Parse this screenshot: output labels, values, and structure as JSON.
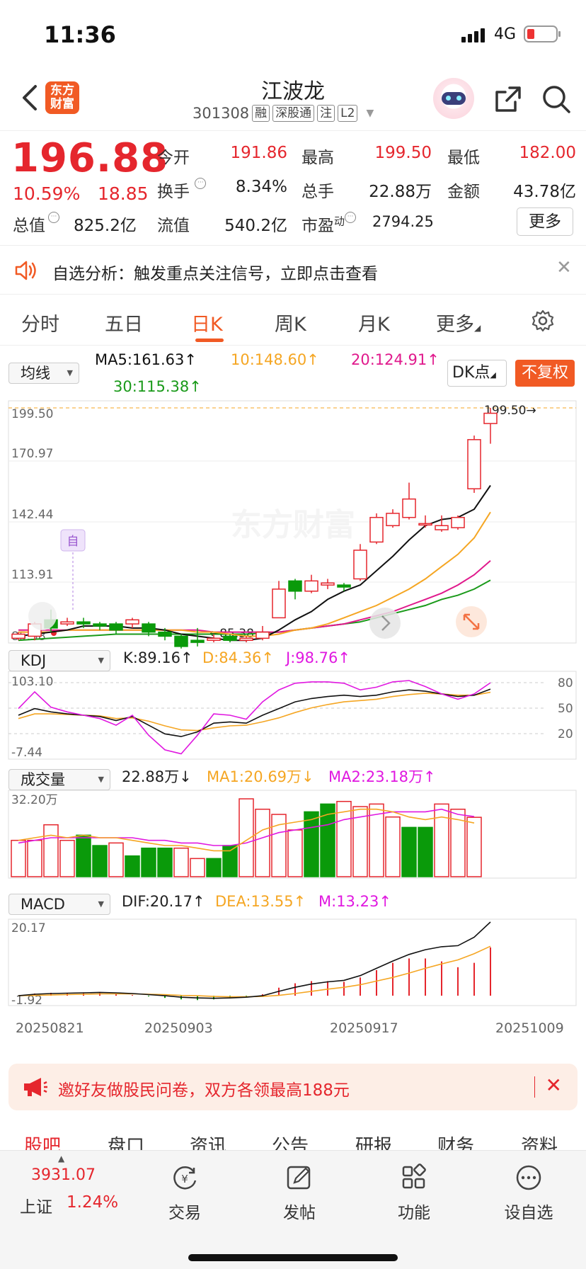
{
  "status_bar": {
    "time": "11:36",
    "network": "4G"
  },
  "header": {
    "title": "江波龙",
    "code": "301308",
    "tags": [
      "融",
      "深股通",
      "注",
      "L2"
    ],
    "logo_text": "东方\n财富"
  },
  "quote": {
    "price": "196.88",
    "change_pct": "10.59%",
    "change": "18.85",
    "open_label": "今开",
    "open": "191.86",
    "high_label": "最高",
    "high": "199.50",
    "low_label": "最低",
    "low": "182.00",
    "turnover_label": "换手",
    "turnover": "8.34%",
    "volume_label": "总手",
    "volume": "22.88万",
    "amount_label": "金额",
    "amount": "43.78亿",
    "mktcap_label": "总值",
    "mktcap": "825.2亿",
    "float_label": "流值",
    "float": "540.2亿",
    "pe_label": "市盈",
    "pe_sup": "动",
    "pe": "2794.25",
    "more_label": "更多"
  },
  "notice": {
    "text": "自选分析：触发重点关注信号，立即点击查看"
  },
  "tabs": [
    {
      "label": "分时"
    },
    {
      "label": "五日"
    },
    {
      "label": "日K"
    },
    {
      "label": "周K"
    },
    {
      "label": "月K"
    },
    {
      "label": "更多"
    }
  ],
  "chart_controls": {
    "ma_select": "均线",
    "ma5": "MA5:161.63↑",
    "ma10": "10:148.60↑",
    "ma20": "20:124.91↑",
    "ma30": "30:115.38↑",
    "dk_label": "DK点",
    "fq_label": "不复权",
    "kdj_select": "KDJ",
    "kdj_k": "K:89.16↑",
    "kdj_d": "D:84.36↑",
    "kdj_j": "J:98.76↑",
    "vol_select": "成交量",
    "vol_value": "22.88万↓",
    "vol_ma1": "MA1:20.69万↓",
    "vol_ma2": "MA2:23.18万↑",
    "macd_select": "MACD",
    "macd_dif": "DIF:20.17↑",
    "macd_dea": "DEA:13.55↑",
    "macd_m": "M:13.23↑",
    "max_marker": "199.50→",
    "min_marker": "←85.38",
    "badge_self": "自",
    "watermark": "东方财富"
  },
  "colors": {
    "up": "#e5262d",
    "down": "#0a9a0a",
    "ma5": "#111111",
    "ma10": "#f5a623",
    "ma20": "#e0198c",
    "ma30": "#1a9a1a",
    "accent": "#f15a24"
  },
  "chart_data": {
    "type": "candlestick",
    "price_axis_ticks": [
      "199.50",
      "170.97",
      "142.44",
      "113.91",
      "85.38"
    ],
    "x_tick_labels": [
      "20250821",
      "20250903",
      "20250917",
      "20251009"
    ],
    "candles": [
      {
        "o": 87,
        "c": 89,
        "h": 90,
        "l": 86
      },
      {
        "o": 88,
        "c": 94,
        "h": 95,
        "l": 86
      },
      {
        "o": 96,
        "c": 92,
        "h": 101,
        "l": 90
      },
      {
        "o": 94,
        "c": 95,
        "h": 97,
        "l": 93
      },
      {
        "o": 95,
        "c": 94,
        "h": 97,
        "l": 92
      },
      {
        "o": 94,
        "c": 93,
        "h": 95,
        "l": 91
      },
      {
        "o": 94,
        "c": 91,
        "h": 95,
        "l": 89
      },
      {
        "o": 94,
        "c": 96,
        "h": 97,
        "l": 92
      },
      {
        "o": 94,
        "c": 90,
        "h": 95,
        "l": 88
      },
      {
        "o": 90,
        "c": 88,
        "h": 92,
        "l": 86
      },
      {
        "o": 88,
        "c": 83,
        "h": 89,
        "l": 82
      },
      {
        "o": 86,
        "c": 85,
        "h": 92,
        "l": 83
      },
      {
        "o": 86,
        "c": 87,
        "h": 89,
        "l": 85
      },
      {
        "o": 88,
        "c": 86,
        "h": 89,
        "l": 85
      },
      {
        "o": 86,
        "c": 87,
        "h": 88,
        "l": 85
      },
      {
        "o": 87,
        "c": 90,
        "h": 93,
        "l": 86
      },
      {
        "o": 97,
        "c": 111,
        "h": 115,
        "l": 97
      },
      {
        "o": 115,
        "c": 110,
        "h": 116,
        "l": 106
      },
      {
        "o": 110,
        "c": 115,
        "h": 118,
        "l": 109
      },
      {
        "o": 113,
        "c": 114,
        "h": 116,
        "l": 111
      },
      {
        "o": 113,
        "c": 112,
        "h": 114,
        "l": 110
      },
      {
        "o": 116,
        "c": 130,
        "h": 133,
        "l": 115
      },
      {
        "o": 134,
        "c": 146,
        "h": 148,
        "l": 133
      },
      {
        "o": 142,
        "c": 148,
        "h": 150,
        "l": 141
      },
      {
        "o": 146,
        "c": 155,
        "h": 163,
        "l": 145
      },
      {
        "o": 143,
        "c": 143,
        "h": 147,
        "l": 141
      },
      {
        "o": 140,
        "c": 142,
        "h": 147,
        "l": 139
      },
      {
        "o": 141,
        "c": 146,
        "h": 147,
        "l": 140
      },
      {
        "o": 160,
        "c": 184,
        "h": 186,
        "l": 158
      },
      {
        "o": 191.86,
        "c": 196.88,
        "h": 199.5,
        "l": 182
      }
    ],
    "ma5": [
      88,
      89,
      90,
      91,
      93,
      93,
      93,
      92,
      92,
      91,
      89,
      88,
      87,
      86,
      86,
      87,
      91,
      96,
      100,
      106,
      110,
      113,
      120,
      127,
      135,
      142,
      145,
      146,
      150,
      161.63
    ],
    "ma10": [
      90,
      90,
      90,
      91,
      91,
      91,
      91,
      91,
      91,
      91,
      91,
      90,
      90,
      89,
      88,
      88,
      89,
      91,
      92,
      94,
      97,
      100,
      103,
      107,
      111,
      116,
      122,
      128,
      136,
      148.6
    ],
    "ma20": [
      91,
      91,
      91,
      91,
      91,
      91,
      91,
      91,
      91,
      91,
      91,
      91,
      90,
      90,
      90,
      90,
      90,
      91,
      92,
      93,
      94,
      96,
      98,
      100,
      103,
      106,
      109,
      113,
      118,
      124.91
    ],
    "ma30": [
      86,
      86.5,
      87,
      87.5,
      88,
      88.5,
      89,
      89,
      89,
      89,
      89,
      89,
      89,
      89,
      89,
      89.5,
      90,
      91,
      92,
      93,
      94,
      95,
      97,
      99,
      101,
      103,
      106,
      108,
      111,
      115.38
    ],
    "kdj_axis_ticks": [
      "103.10",
      "-7.44"
    ],
    "kdj_levels": [
      "80",
      "50",
      "20"
    ],
    "kdj_K": [
      50,
      60,
      55,
      52,
      50,
      48,
      42,
      48,
      35,
      22,
      18,
      25,
      38,
      40,
      38,
      50,
      60,
      70,
      75,
      78,
      80,
      78,
      80,
      85,
      88,
      86,
      82,
      78,
      80,
      89.16
    ],
    "kdj_D": [
      45,
      52,
      52,
      51,
      50,
      49,
      45,
      46,
      41,
      34,
      28,
      27,
      31,
      34,
      35,
      40,
      46,
      54,
      61,
      66,
      70,
      72,
      74,
      78,
      81,
      83,
      82,
      80,
      80,
      84.36
    ],
    "kdj_J": [
      60,
      85,
      62,
      55,
      50,
      45,
      35,
      50,
      20,
      -2,
      -8,
      20,
      52,
      50,
      44,
      70,
      88,
      98,
      100,
      100,
      98,
      88,
      92,
      100,
      102,
      93,
      82,
      74,
      82,
      98.76
    ],
    "volume_axis_ticks": [
      "32.20万"
    ],
    "volume": [
      14,
      14,
      20,
      14,
      16,
      12,
      13,
      8,
      11,
      11,
      11,
      7,
      7,
      12,
      30,
      26,
      24,
      18,
      25,
      28,
      29,
      27,
      28,
      23,
      19,
      19,
      28,
      26,
      22.88
    ],
    "volume_up": [
      true,
      true,
      true,
      true,
      false,
      false,
      true,
      false,
      false,
      false,
      true,
      true,
      false,
      false,
      true,
      true,
      true,
      true,
      false,
      false,
      true,
      true,
      true,
      true,
      false,
      false,
      true,
      true,
      true
    ],
    "vol_ma1": [
      14,
      15,
      16,
      15,
      16,
      15,
      15,
      14,
      13,
      12,
      12,
      11,
      10,
      10,
      14,
      18,
      20,
      21,
      22,
      24,
      25,
      26,
      26,
      25,
      23,
      22,
      23,
      22,
      20.69
    ],
    "vol_ma2": [
      13,
      14,
      15,
      15,
      15,
      15,
      15,
      15,
      14,
      14,
      13,
      13,
      12,
      12,
      13,
      15,
      17,
      18,
      19,
      20,
      22,
      23,
      24,
      25,
      25,
      25,
      26,
      24,
      23.18
    ],
    "macd_axis_ticks": [
      "20.17",
      "-1.92"
    ],
    "macd_dif": [
      0,
      0.4,
      0.6,
      0.7,
      0.8,
      0.9,
      0.8,
      0.6,
      0.3,
      0,
      -0.4,
      -0.6,
      -0.7,
      -0.6,
      -0.4,
      0,
      1.2,
      2.3,
      3.2,
      3.8,
      4.2,
      5.5,
      7.5,
      9.5,
      11.3,
      12.6,
      13.4,
      13.7,
      16,
      20.17
    ],
    "macd_dea": [
      0,
      0.1,
      0.2,
      0.3,
      0.4,
      0.5,
      0.5,
      0.5,
      0.4,
      0.3,
      0.1,
      0,
      -0.2,
      -0.3,
      -0.3,
      -0.2,
      0.1,
      0.6,
      1.2,
      1.8,
      2.3,
      3,
      4,
      5,
      6.2,
      7.5,
      8.7,
      9.8,
      11.5,
      13.55
    ],
    "macd_m": [
      0,
      0.6,
      0.8,
      0.8,
      0.8,
      0.8,
      0.6,
      0.2,
      -0.2,
      -0.6,
      -1,
      -1.2,
      -1,
      -0.6,
      -0.2,
      0.4,
      2.2,
      3.4,
      4,
      4,
      3.8,
      5,
      7,
      9,
      10.2,
      10.2,
      9.4,
      7.8,
      9,
      13.23
    ]
  },
  "promo": {
    "text": "邀好友做股民问卷，双方各领最高188元"
  },
  "sub_tabs": [
    {
      "label": "股吧"
    },
    {
      "label": "盘口"
    },
    {
      "label": "资讯"
    },
    {
      "label": "公告"
    },
    {
      "label": "研报"
    },
    {
      "label": "财务"
    },
    {
      "label": "资料"
    }
  ],
  "bottom_bar": {
    "index_value": "3931.07",
    "index_name": "上证",
    "index_pct": "1.24%",
    "items": [
      {
        "label": "交易"
      },
      {
        "label": "发帖"
      },
      {
        "label": "功能"
      },
      {
        "label": "设自选"
      }
    ]
  }
}
